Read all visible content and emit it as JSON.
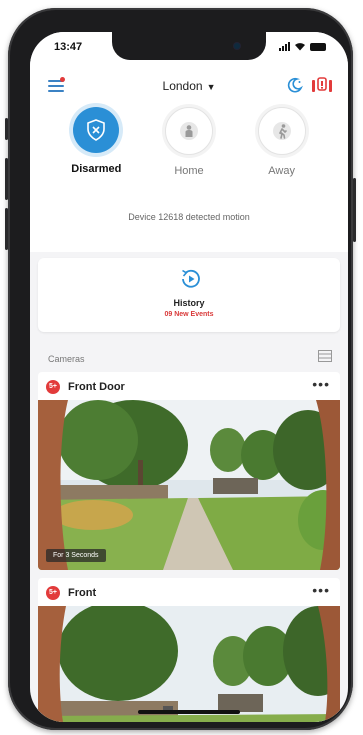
{
  "status_bar": {
    "time": "13:47"
  },
  "header": {
    "location": "London"
  },
  "modes": [
    {
      "label": "Disarmed",
      "active": true
    },
    {
      "label": "Home",
      "active": false
    },
    {
      "label": "Away",
      "active": false
    }
  ],
  "status_message": "Device 12618 detected motion",
  "history": {
    "title": "History",
    "subtitle": "09 New Events"
  },
  "cameras": {
    "section_label": "Cameras",
    "items": [
      {
        "badge": "5+",
        "name": "Front Door",
        "recording_label": "For 3 Seconds"
      },
      {
        "badge": "5+",
        "name": "Front"
      }
    ]
  },
  "colors": {
    "accent": "#2a8fd6",
    "alert": "#e23b3b"
  }
}
